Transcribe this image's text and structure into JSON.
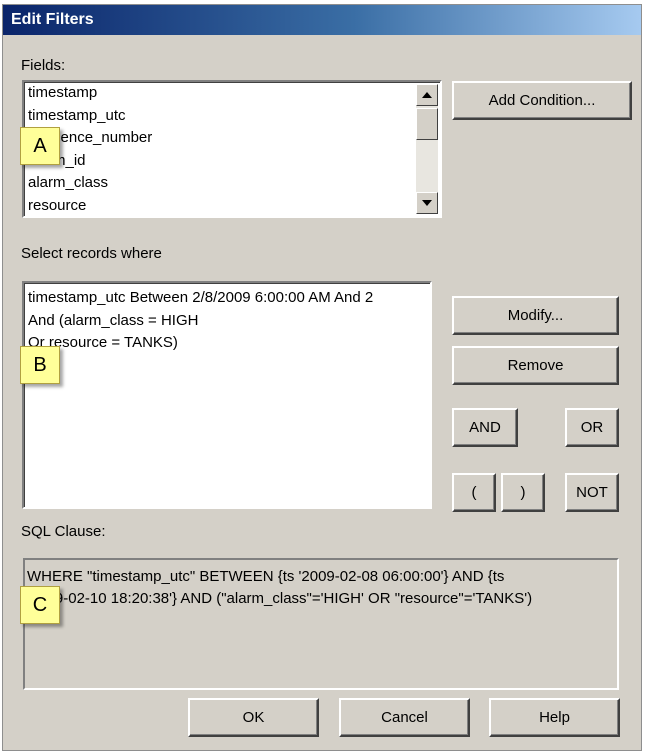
{
  "window": {
    "title": "Edit Filters"
  },
  "fields": {
    "label": "Fields:",
    "items": [
      "timestamp",
      "timestamp_utc",
      "sequence_number",
      "alarm_id",
      "alarm_class",
      "resource"
    ],
    "add_condition_label": "Add Condition..."
  },
  "records": {
    "label": "Select records where",
    "lines": [
      "timestamp_utc Between 2/8/2009 6:00:00 AM And 2",
      "And (alarm_class = HIGH",
      "Or resource = TANKS)"
    ],
    "modify_label": "Modify...",
    "remove_label": "Remove",
    "and_label": "AND",
    "or_label": "OR",
    "open_paren_label": "(",
    "close_paren_label": ")",
    "not_label": "NOT"
  },
  "sql": {
    "label": "SQL Clause:",
    "lines": [
      "WHERE \"timestamp_utc\" BETWEEN {ts '2009-02-08 06:00:00'} AND {ts",
      "'2009-02-10 18:20:38'} AND (\"alarm_class\"='HIGH' OR \"resource\"='TANKS')"
    ]
  },
  "footer": {
    "ok_label": "OK",
    "cancel_label": "Cancel",
    "help_label": "Help"
  },
  "callouts": {
    "a": "A",
    "b": "B",
    "c": "C"
  },
  "icons": {
    "scroll_up": "scroll-up-arrow-icon",
    "scroll_down": "scroll-down-arrow-icon"
  },
  "colors": {
    "dialog_bg": "#d4d0c8",
    "title_start": "#0a246a",
    "title_end": "#a6caf0",
    "callout_bg": "#ffff99"
  }
}
